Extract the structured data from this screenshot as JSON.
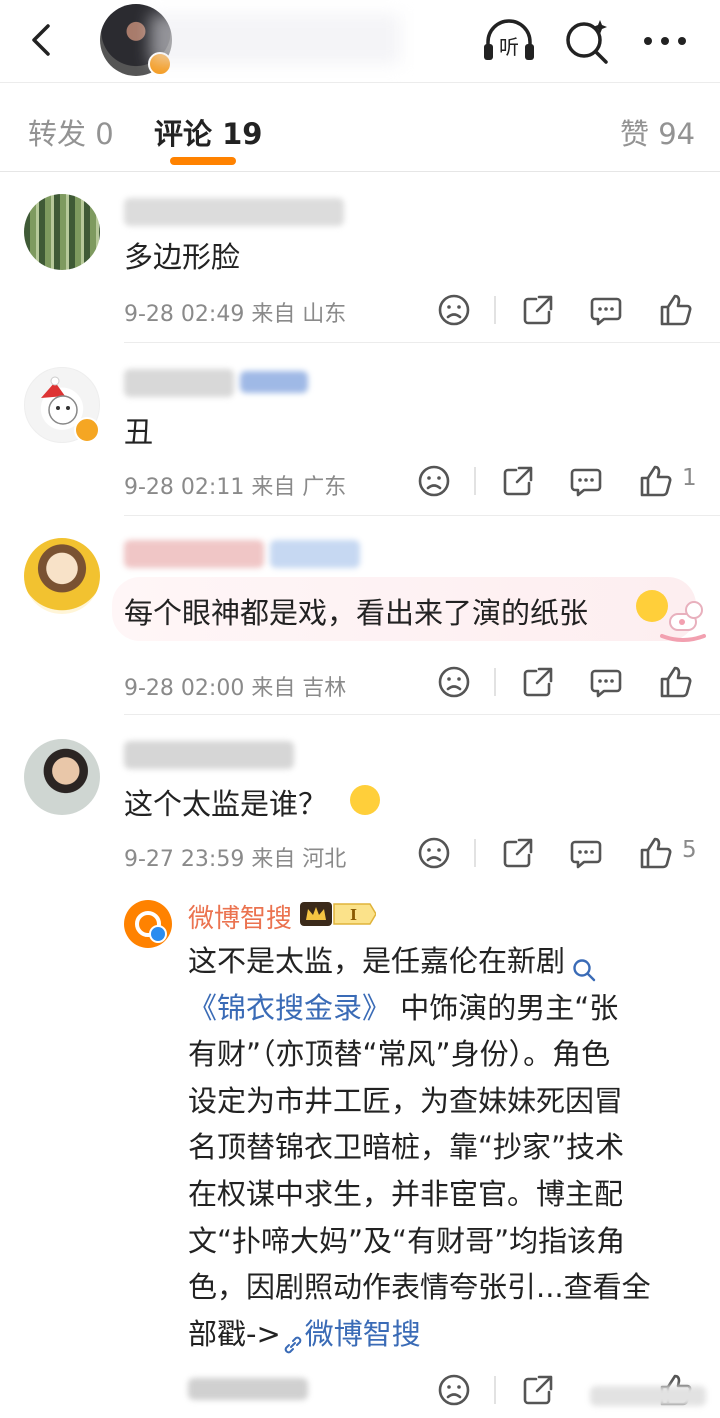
{
  "tabs": [
    {
      "label": "转发 0"
    },
    {
      "label": "评论 19"
    },
    {
      "label": "赞 94"
    }
  ],
  "comments": [
    {
      "text": "多边形脸",
      "meta": "9-28 02:49  来自 山东",
      "likes": ""
    },
    {
      "text": "丑",
      "meta": "9-28 02:11  来自 广东",
      "likes": "1"
    },
    {
      "text": "每个眼神都是戏，看出来了演的纸张",
      "meta": "9-28 02:00  来自 吉林",
      "likes": ""
    },
    {
      "text": "这个太监是谁？",
      "meta": "9-27 23:59  来自 河北",
      "likes": "5"
    }
  ],
  "reply": {
    "name": "微博智搜",
    "lines": [
      "这不是太监，是任嘉伦在新剧",
      "《锦衣搜金录》",
      "中饰演的男主“张",
      "有财”（亦顶替“常风”身份）。角色",
      "设定为市井工匠，为查妹妹死因冒",
      "名顶替锦衣卫暗桩，靠“抄家”技术",
      "在权谋中求生，并非宦官。博主配",
      "文“扑啼大妈”及“有财哥”均指该角",
      "色，因剧照动作表情夸张引...查看全",
      "部戳->",
      "微博智搜"
    ]
  },
  "icons": [
    "back-arrow-icon",
    "listen-icon",
    "search-icon",
    "more-icon",
    "dislike-icon",
    "share-icon",
    "reply-icon",
    "like-icon"
  ],
  "colors": {
    "accent": "#ff8200",
    "link": "#3a6bb6",
    "reply_name": "#eb7350",
    "meta": "#8a8a8a"
  }
}
